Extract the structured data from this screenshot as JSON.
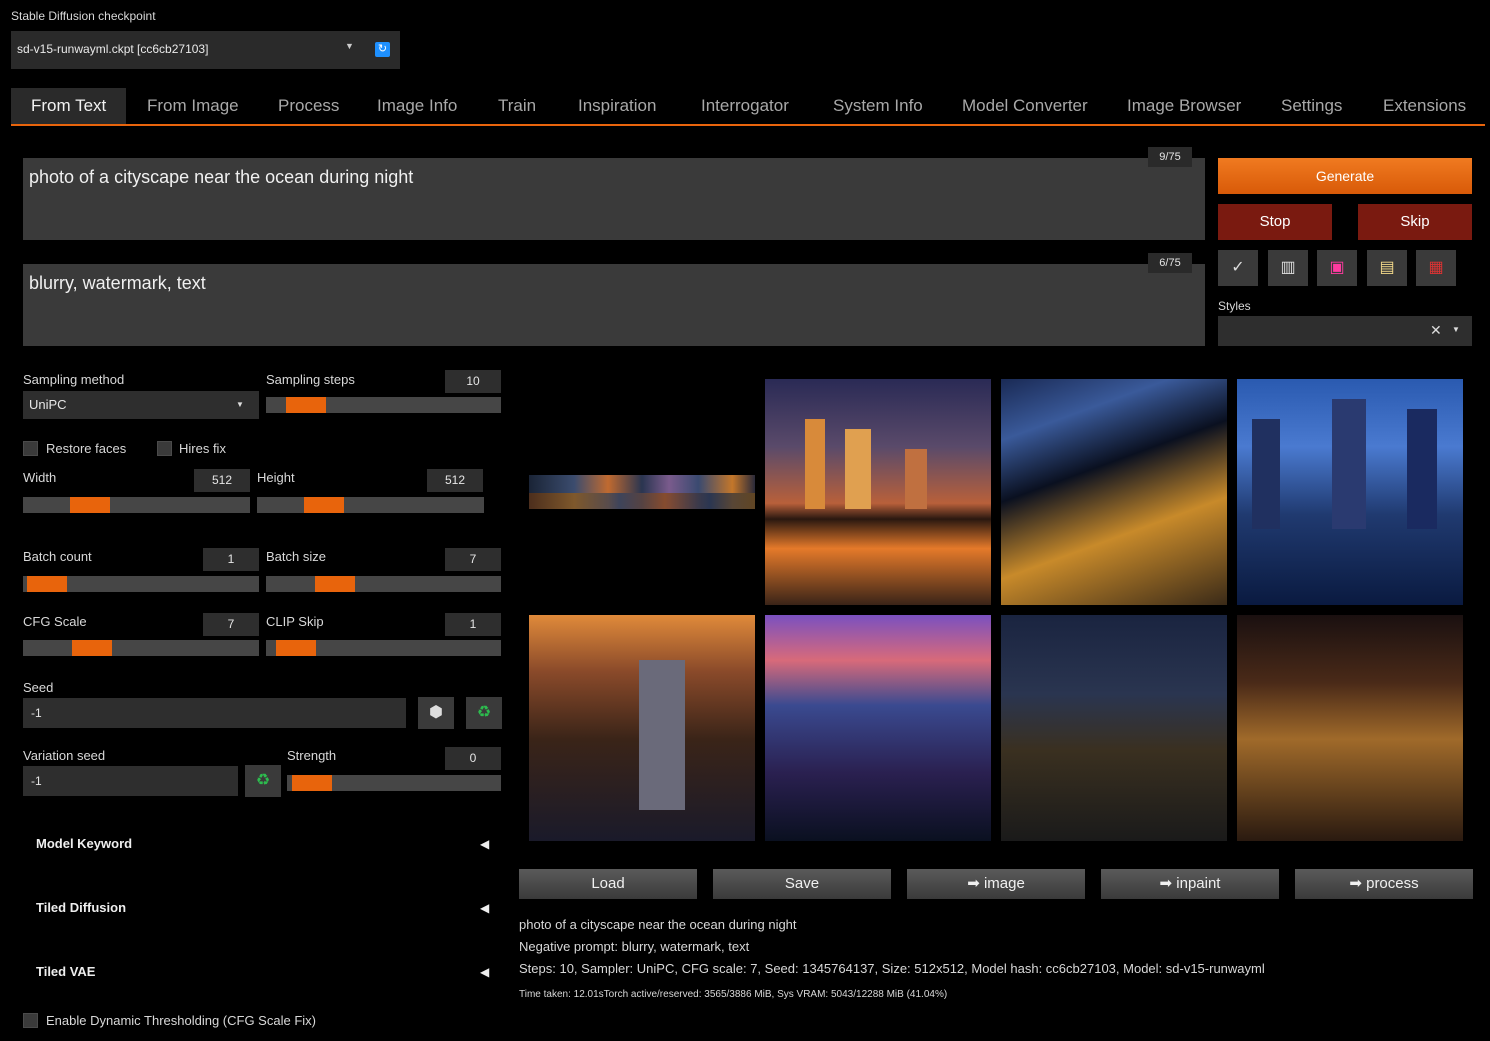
{
  "checkpoint": {
    "label": "Stable Diffusion checkpoint",
    "value": "sd-v15-runwayml.ckpt [cc6cb27103]",
    "refresh_icon": "refresh-icon"
  },
  "tabs": [
    "From Text",
    "From Image",
    "Process",
    "Image Info",
    "Train",
    "Inspiration",
    "Interrogator",
    "System Info",
    "Model Converter",
    "Image Browser",
    "Settings",
    "Extensions"
  ],
  "prompt": {
    "text": "photo of a cityscape near the ocean during night",
    "token_count": "9/75"
  },
  "negative_prompt": {
    "text": "blurry, watermark, text",
    "token_count": "6/75"
  },
  "buttons": {
    "generate": "Generate",
    "stop": "Stop",
    "skip": "Skip"
  },
  "tool_icons": [
    "pencil-icon",
    "trash-icon",
    "image-icon",
    "clipboard-icon",
    "save-icon"
  ],
  "styles": {
    "label": "Styles",
    "value": ""
  },
  "params": {
    "sampling_method_label": "Sampling method",
    "sampling_method": "UniPC",
    "sampling_steps_label": "Sampling steps",
    "sampling_steps": "10",
    "restore_faces": "Restore faces",
    "hires_fix": "Hires fix",
    "width_label": "Width",
    "width": "512",
    "height_label": "Height",
    "height": "512",
    "batch_count_label": "Batch count",
    "batch_count": "1",
    "batch_size_label": "Batch size",
    "batch_size": "7",
    "cfg_label": "CFG Scale",
    "cfg": "7",
    "clip_skip_label": "CLIP Skip",
    "clip_skip": "1",
    "seed_label": "Seed",
    "seed": "-1",
    "variation_seed_label": "Variation seed",
    "variation_seed": "-1",
    "strength_label": "Strength",
    "strength": "0"
  },
  "slider_levels": {
    "sampling_steps": 0.1,
    "width": 0.25,
    "height": 0.25,
    "batch_count": 0.02,
    "batch_size": 0.25,
    "cfg": 0.25,
    "clip_skip": 0.05,
    "strength": 0.03
  },
  "accordions": [
    "Model Keyword",
    "Tiled Diffusion",
    "Tiled VAE"
  ],
  "dynamic_thresholding": "Enable Dynamic Thresholding (CFG Scale Fix)",
  "gallery_actions": [
    "Load",
    "Save",
    "➡ image",
    "➡ inpaint",
    "➡ process"
  ],
  "output_info": {
    "prompt": "photo of a cityscape near the ocean during night",
    "negative": "Negative prompt: blurry, watermark, text",
    "params": "Steps: 10, Sampler: UniPC, CFG scale: 7, Seed: 1345764137, Size: 512x512, Model hash: cc6cb27103, Model: sd-v15-runwayml",
    "time": "Time taken: 12.01sTorch active/reserved: 3565/3886 MiB, Sys VRAM: 5043/12288 MiB (41.04%)"
  },
  "colors": {
    "accent": "#e8640c",
    "stop_bg": "#7a1a10",
    "background": "#000000"
  }
}
